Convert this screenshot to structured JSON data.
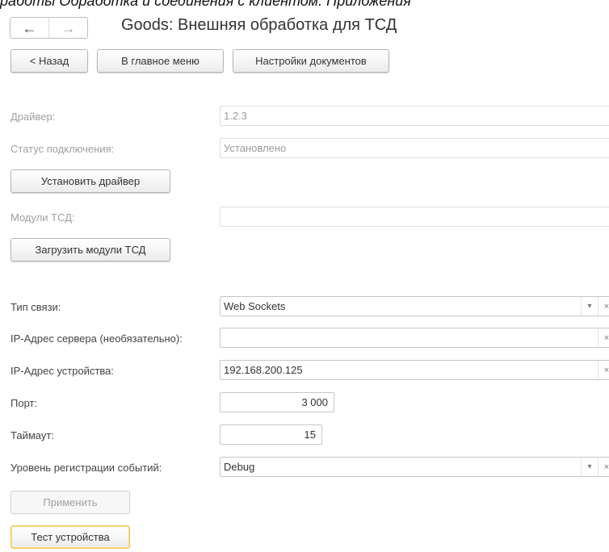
{
  "header": {
    "cut_caption": "работы Обработка и соединения с клиентом. Приложения",
    "title": "Goods: Внешняя обработка для ТСД",
    "back_icon": "←",
    "forward_icon": "→"
  },
  "toolbar": {
    "back_label": "< Назад",
    "main_menu_label": "В главное меню",
    "doc_settings_label": "Настройки документов"
  },
  "driver": {
    "label": "Драйвер:",
    "value": "1.2.3"
  },
  "connection_status": {
    "label": "Статус подключения:",
    "value": "Установлено"
  },
  "install_driver_label": "Установить драйвер",
  "tsd_modules": {
    "label": "Модули ТСД:",
    "value": ""
  },
  "load_modules_label": "Загрузить модули ТСД",
  "link_type": {
    "label": "Тип связи:",
    "value": "Web Sockets"
  },
  "server_ip": {
    "label": "IP-Адрес сервера (необязательно):",
    "value": ""
  },
  "device_ip": {
    "label": "IP-Адрес устройства:",
    "value": "192.168.200.125"
  },
  "port": {
    "label": "Порт:",
    "value": "3 000"
  },
  "timeout": {
    "label": "Таймаут:",
    "value": "15"
  },
  "log_level": {
    "label": "Уровень регистрации событий:",
    "value": "Debug"
  },
  "apply_label": "Применить",
  "test_device_label": "Тест устройства",
  "icons": {
    "dropdown": "▾",
    "clear": "×"
  }
}
